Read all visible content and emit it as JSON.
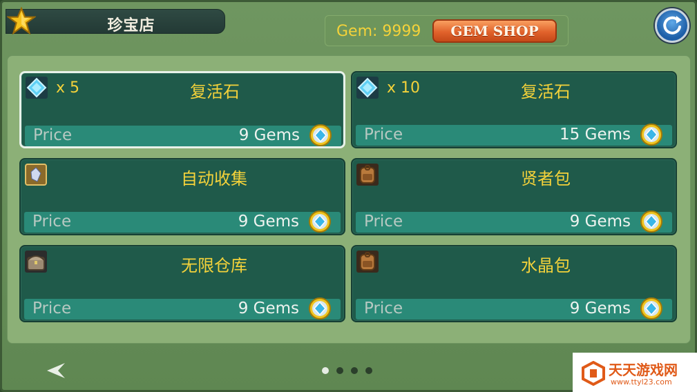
{
  "header": {
    "title": "珍宝店",
    "gem_label": "Gem: 9999",
    "gem_shop_button": "GEM SHOP"
  },
  "items": [
    {
      "icon": "blue-gem-icon",
      "qty": "x 5",
      "name": "复活石",
      "price_label": "Price",
      "price": "9 Gems",
      "selected": true
    },
    {
      "icon": "blue-gem-icon",
      "qty": "x 10",
      "name": "复活石",
      "price_label": "Price",
      "price": "15 Gems",
      "selected": false
    },
    {
      "icon": "crystal-scroll-icon",
      "qty": "",
      "name": "自动收集",
      "price_label": "Price",
      "price": "9 Gems",
      "selected": false
    },
    {
      "icon": "backpack-icon",
      "qty": "",
      "name": "贤者包",
      "price_label": "Price",
      "price": "9 Gems",
      "selected": false
    },
    {
      "icon": "storage-chest-icon",
      "qty": "",
      "name": "无限仓库",
      "price_label": "Price",
      "price": "9 Gems",
      "selected": false
    },
    {
      "icon": "backpack-icon",
      "qty": "",
      "name": "水晶包",
      "price_label": "Price",
      "price": "9 Gems",
      "selected": false
    }
  ],
  "pagination": {
    "pages": 4,
    "current": 1
  },
  "watermark": {
    "title": "天天游戏网",
    "url": "www.ttyl23.com"
  },
  "colors": {
    "accent_text": "#f4d23a",
    "card_bg": "#1f5a4a",
    "price_bar": "#2a8a78",
    "gem_shop_button": "#e1622b"
  }
}
